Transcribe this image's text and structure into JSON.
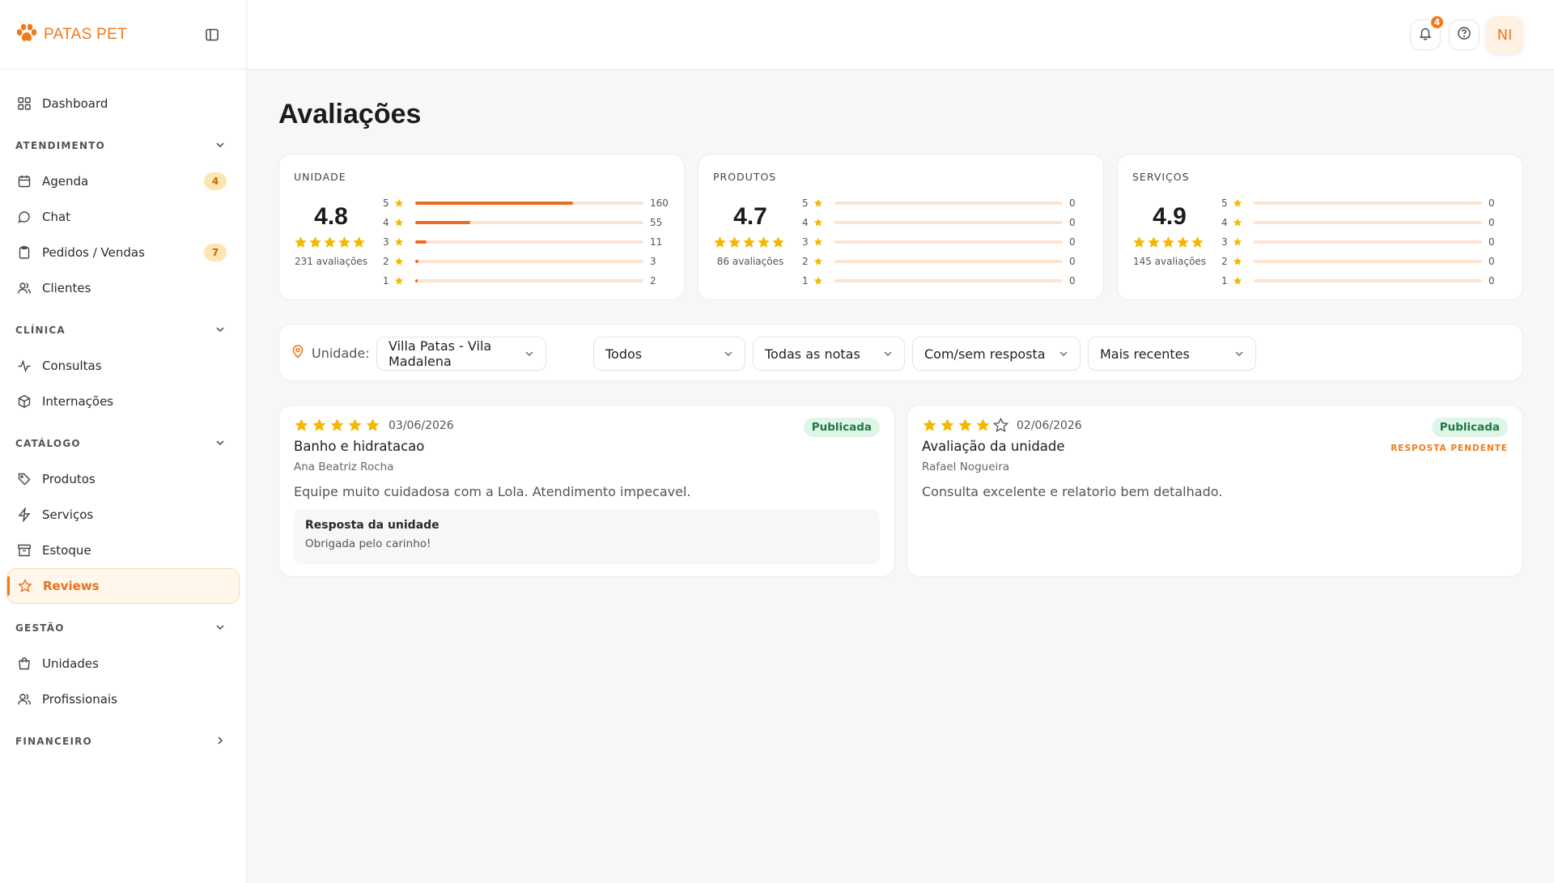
{
  "brand": {
    "name": "PATAS PET",
    "accent": "#f07a1a"
  },
  "sidebar": {
    "dashboard": "Dashboard",
    "sections": [
      {
        "label": "ATENDIMENTO",
        "items": [
          {
            "label": "Agenda",
            "badge": "4",
            "icon": "calendar-icon"
          },
          {
            "label": "Chat",
            "icon": "chat-icon"
          },
          {
            "label": "Pedidos / Vendas",
            "badge": "7",
            "icon": "clipboard-icon"
          },
          {
            "label": "Clientes",
            "icon": "users-icon"
          }
        ]
      },
      {
        "label": "CLÍNICA",
        "items": [
          {
            "label": "Consultas",
            "icon": "activity-icon"
          },
          {
            "label": "Internações",
            "icon": "box-icon"
          }
        ]
      },
      {
        "label": "CATÁLOGO",
        "items": [
          {
            "label": "Produtos",
            "icon": "tag-icon"
          },
          {
            "label": "Serviços",
            "icon": "zap-icon"
          },
          {
            "label": "Estoque",
            "icon": "archive-icon"
          },
          {
            "label": "Reviews",
            "icon": "star-icon",
            "active": true
          }
        ]
      },
      {
        "label": "GESTÃO",
        "items": [
          {
            "label": "Unidades",
            "icon": "store-icon"
          },
          {
            "label": "Profissionais",
            "icon": "users-icon"
          }
        ]
      },
      {
        "label": "FINANCEIRO",
        "items": []
      }
    ]
  },
  "topbar": {
    "notifications": "4",
    "avatar_initials": "NI"
  },
  "page": {
    "title": "Avaliações"
  },
  "stats": [
    {
      "title": "UNIDADE",
      "avg": "4.8",
      "count": "231 avaliações",
      "rows": [
        {
          "star": "5",
          "n": "160",
          "pct": 0.69
        },
        {
          "star": "4",
          "n": "55",
          "pct": 0.24
        },
        {
          "star": "3",
          "n": "11",
          "pct": 0.05
        },
        {
          "star": "2",
          "n": "3",
          "pct": 0.013
        },
        {
          "star": "1",
          "n": "2",
          "pct": 0.009
        }
      ]
    },
    {
      "title": "PRODUTOS",
      "avg": "4.7",
      "count": "86 avaliações",
      "rows": [
        {
          "star": "5",
          "n": "0",
          "pct": 0
        },
        {
          "star": "4",
          "n": "0",
          "pct": 0
        },
        {
          "star": "3",
          "n": "0",
          "pct": 0
        },
        {
          "star": "2",
          "n": "0",
          "pct": 0
        },
        {
          "star": "1",
          "n": "0",
          "pct": 0
        }
      ]
    },
    {
      "title": "SERVIÇOS",
      "avg": "4.9",
      "count": "145 avaliações",
      "rows": [
        {
          "star": "5",
          "n": "0",
          "pct": 0
        },
        {
          "star": "4",
          "n": "0",
          "pct": 0
        },
        {
          "star": "3",
          "n": "0",
          "pct": 0
        },
        {
          "star": "2",
          "n": "0",
          "pct": 0
        },
        {
          "star": "1",
          "n": "0",
          "pct": 0
        }
      ]
    }
  ],
  "filters": {
    "unit_label": "Unidade:",
    "unit": "Villa Patas - Vila Madalena",
    "type": "Todos",
    "rating": "Todas as notas",
    "response": "Com/sem resposta",
    "sort": "Mais recentes"
  },
  "reviews": [
    {
      "rating": 5,
      "date": "03/06/2026",
      "status": "Publicada",
      "title": "Banho e hidratacao",
      "author": "Ana Beatriz Rocha",
      "text": "Equipe muito cuidadosa com a Lola. Atendimento impecavel.",
      "reply_title": "Resposta da unidade",
      "reply_text": "Obrigada pelo carinho!"
    },
    {
      "rating": 4,
      "date": "02/06/2026",
      "status": "Publicada",
      "pending": "RESPOSTA PENDENTE",
      "title": "Avaliação da unidade",
      "author": "Rafael Nogueira",
      "text": "Consulta excelente e relatorio bem detalhado."
    }
  ]
}
